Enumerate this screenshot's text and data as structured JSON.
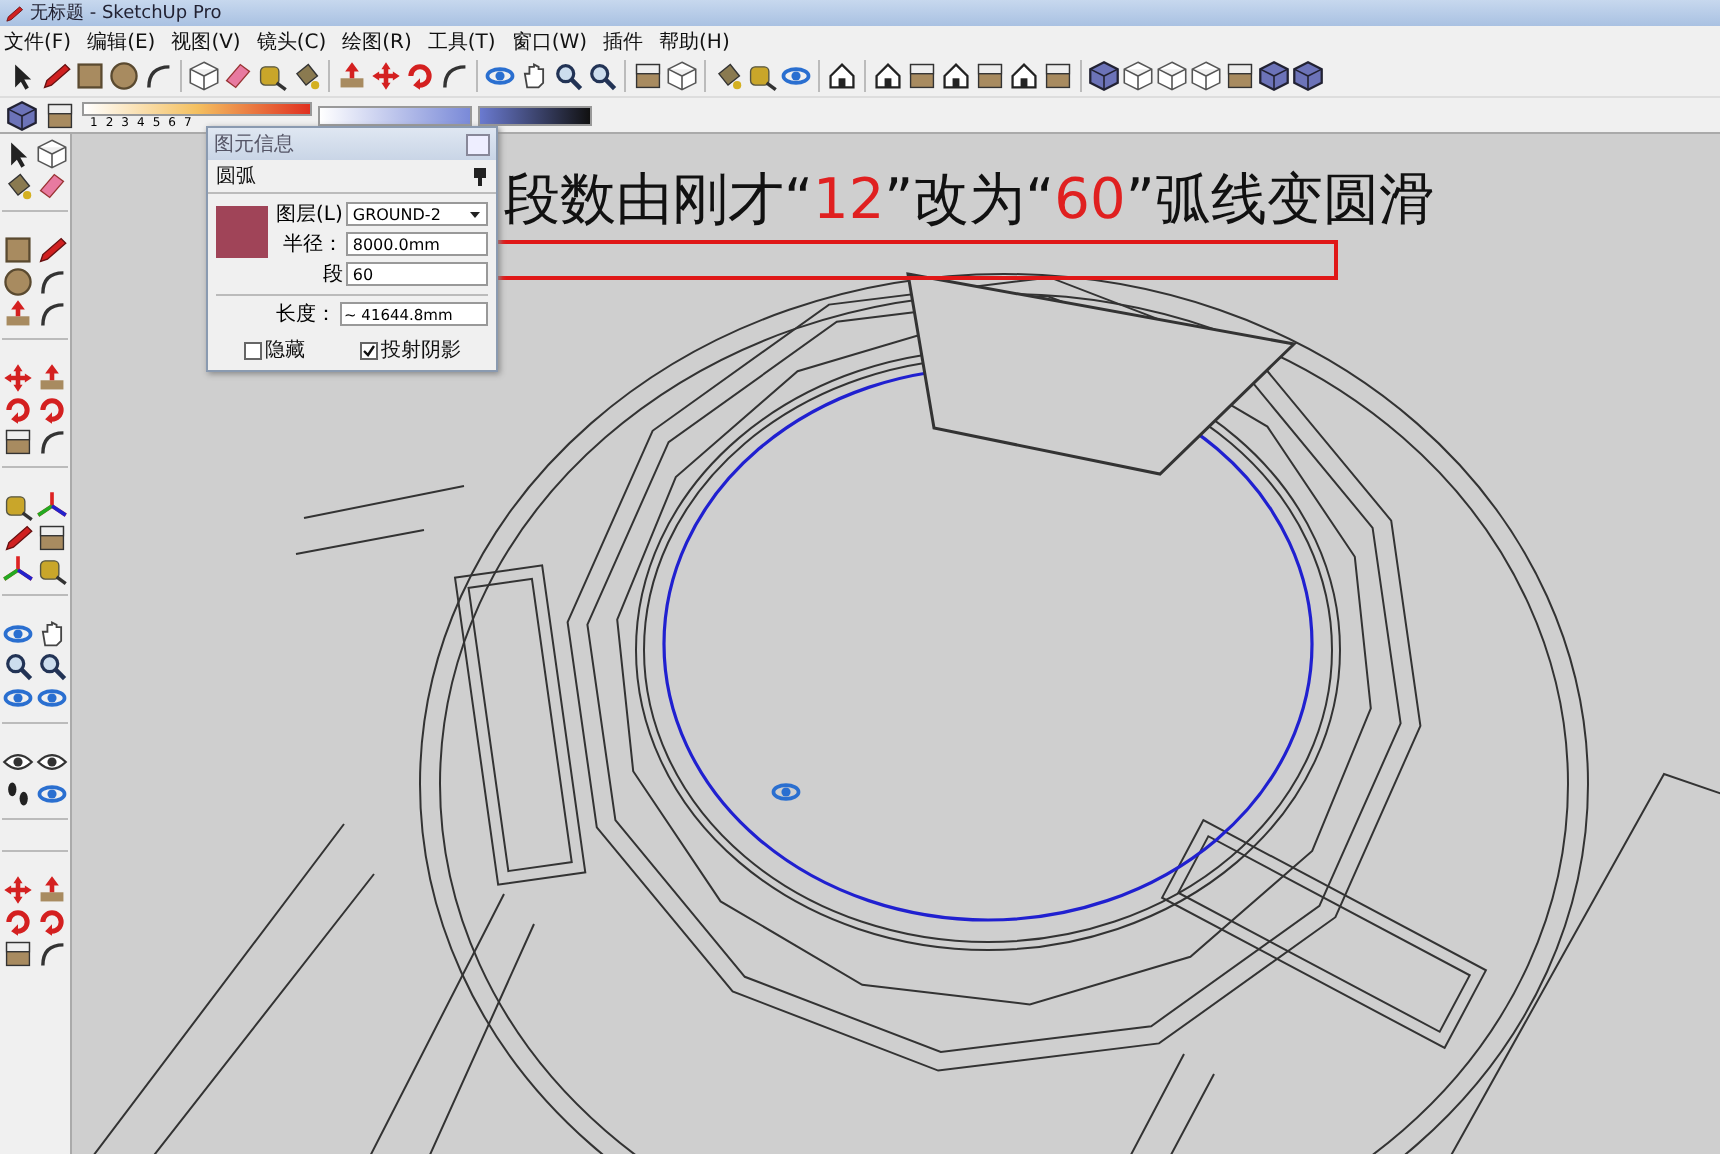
{
  "window": {
    "title": "无标题 - SketchUp Pro"
  },
  "menu": [
    {
      "label": "文件(F)"
    },
    {
      "label": "编辑(E)"
    },
    {
      "label": "视图(V)"
    },
    {
      "label": "镜头(C)"
    },
    {
      "label": "绘图(R)"
    },
    {
      "label": "工具(T)"
    },
    {
      "label": "窗口(W)"
    },
    {
      "label": "插件"
    },
    {
      "label": "帮助(H)"
    }
  ],
  "color_scale": {
    "labels": [
      "1",
      "2",
      "3",
      "4",
      "5",
      "6",
      "7"
    ]
  },
  "entity_info": {
    "title": "图元信息",
    "entity_type": "圆弧",
    "layer": {
      "label": "图层(L)",
      "value": "GROUND-2"
    },
    "radius": {
      "label": "半径：",
      "value": "8000.0mm"
    },
    "segments": {
      "label": "段",
      "value": "60"
    },
    "length": {
      "label": "长度：",
      "value": "~ 41644.8mm"
    },
    "checkboxes": [
      {
        "label": "隐藏",
        "checked": false
      },
      {
        "label": "投射阴影",
        "checked": true
      }
    ]
  },
  "caption": {
    "parts": [
      {
        "text": "段数由刚才“",
        "highlight": false
      },
      {
        "text": "12",
        "highlight": true
      },
      {
        "text": "”改为“",
        "highlight": false
      },
      {
        "text": "60",
        "highlight": true
      },
      {
        "text": "”弧线变圆滑",
        "highlight": false
      }
    ]
  }
}
